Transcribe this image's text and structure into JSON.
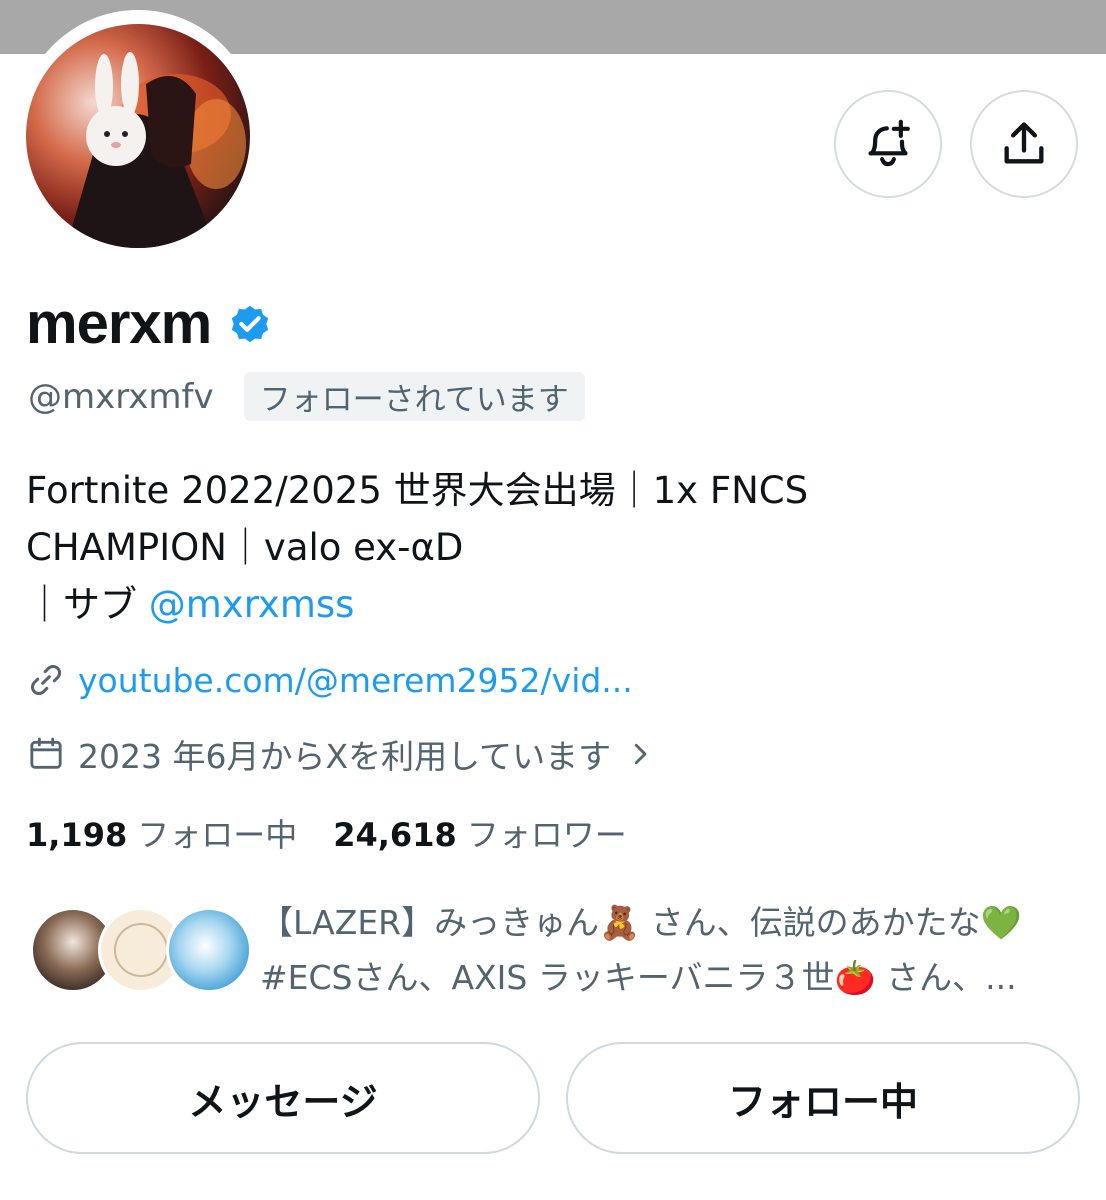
{
  "profile": {
    "display_name": "merxm",
    "handle": "@mxrxmfv",
    "follows_you_badge": "フォローされています",
    "bio": {
      "line1": "Fortnite 2022/2025 世界大会出場｜1x FNCS",
      "line2": "CHAMPION｜valo ex-αD",
      "line3_prefix": "｜サブ ",
      "line3_mention": "@mxrxmss"
    },
    "website": "youtube.com/@merem2952/vid...",
    "joined": "2023 年6月からXを利用しています",
    "following_count": "1,198",
    "following_label": "フォロー中",
    "followers_count": "24,618",
    "followers_label": "フォロワー"
  },
  "followed_by": {
    "line1": "【LAZER】みっきゅん🧸 さん、伝説のあかたな💚",
    "line2": "#ECSさん、AXIS ラッキーバニラ３世🍅 さん、..."
  },
  "buttons": {
    "message": "メッセージ",
    "following": "フォロー中"
  },
  "colors": {
    "accent": "#1d9bf0",
    "verified": "#1d9bf0",
    "text_primary": "#0f1419",
    "text_secondary": "#536471",
    "border": "#cfd9de",
    "banner": "#a8a8a8"
  },
  "icons": {
    "notify": "bell-plus-icon",
    "share": "share-icon",
    "verified": "verified-badge-icon",
    "link": "link-icon",
    "calendar": "calendar-icon",
    "chevron": "chevron-right-icon"
  }
}
